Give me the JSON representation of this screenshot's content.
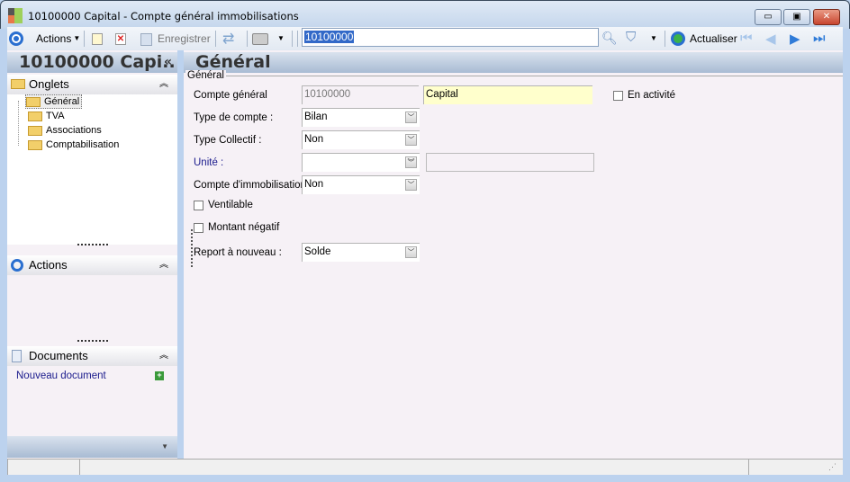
{
  "window": {
    "title": "10100000 Capital -  Compte général immobilisations",
    "minimize": "▭",
    "maximize": "▣",
    "close": "✕",
    "close_color": "#c8452f"
  },
  "toolbar": {
    "actions": "Actions",
    "save": "Enregistrer",
    "search_value": "10100000",
    "refresh": "Actualiser"
  },
  "left": {
    "header": "10100000 Capi..",
    "collapse": "«",
    "onglets": {
      "title": "Onglets",
      "items": [
        {
          "label": "Général"
        },
        {
          "label": "TVA"
        },
        {
          "label": "Associations"
        },
        {
          "label": "Comptabilisation"
        }
      ]
    },
    "actions": {
      "title": "Actions"
    },
    "documents": {
      "title": "Documents",
      "new": "Nouveau document"
    }
  },
  "main": {
    "header": "Général",
    "group": "Général",
    "fields": {
      "compte_general": {
        "label": "Compte général",
        "value": "10100000",
        "name": "Capital"
      },
      "type_compte": {
        "label": "Type de compte :",
        "value": "Bilan"
      },
      "type_collectif": {
        "label": "Type Collectif :",
        "value": "Non"
      },
      "unite": {
        "label": "Unité :",
        "value": ""
      },
      "compte_immo": {
        "label": "Compte d'immobilisation :",
        "value": "Non"
      },
      "ventilable": {
        "label": "Ventilable",
        "checked": false
      },
      "montant_negatif": {
        "label": "Montant négatif",
        "checked": false
      },
      "report": {
        "label": "Report à nouveau :",
        "value": "Solde"
      },
      "en_activite": {
        "label": "En activité",
        "checked": false
      }
    }
  },
  "colors": {
    "accent": "#3269c8",
    "link": "#1a1a8c",
    "highlight_field": "#ffffcc"
  }
}
